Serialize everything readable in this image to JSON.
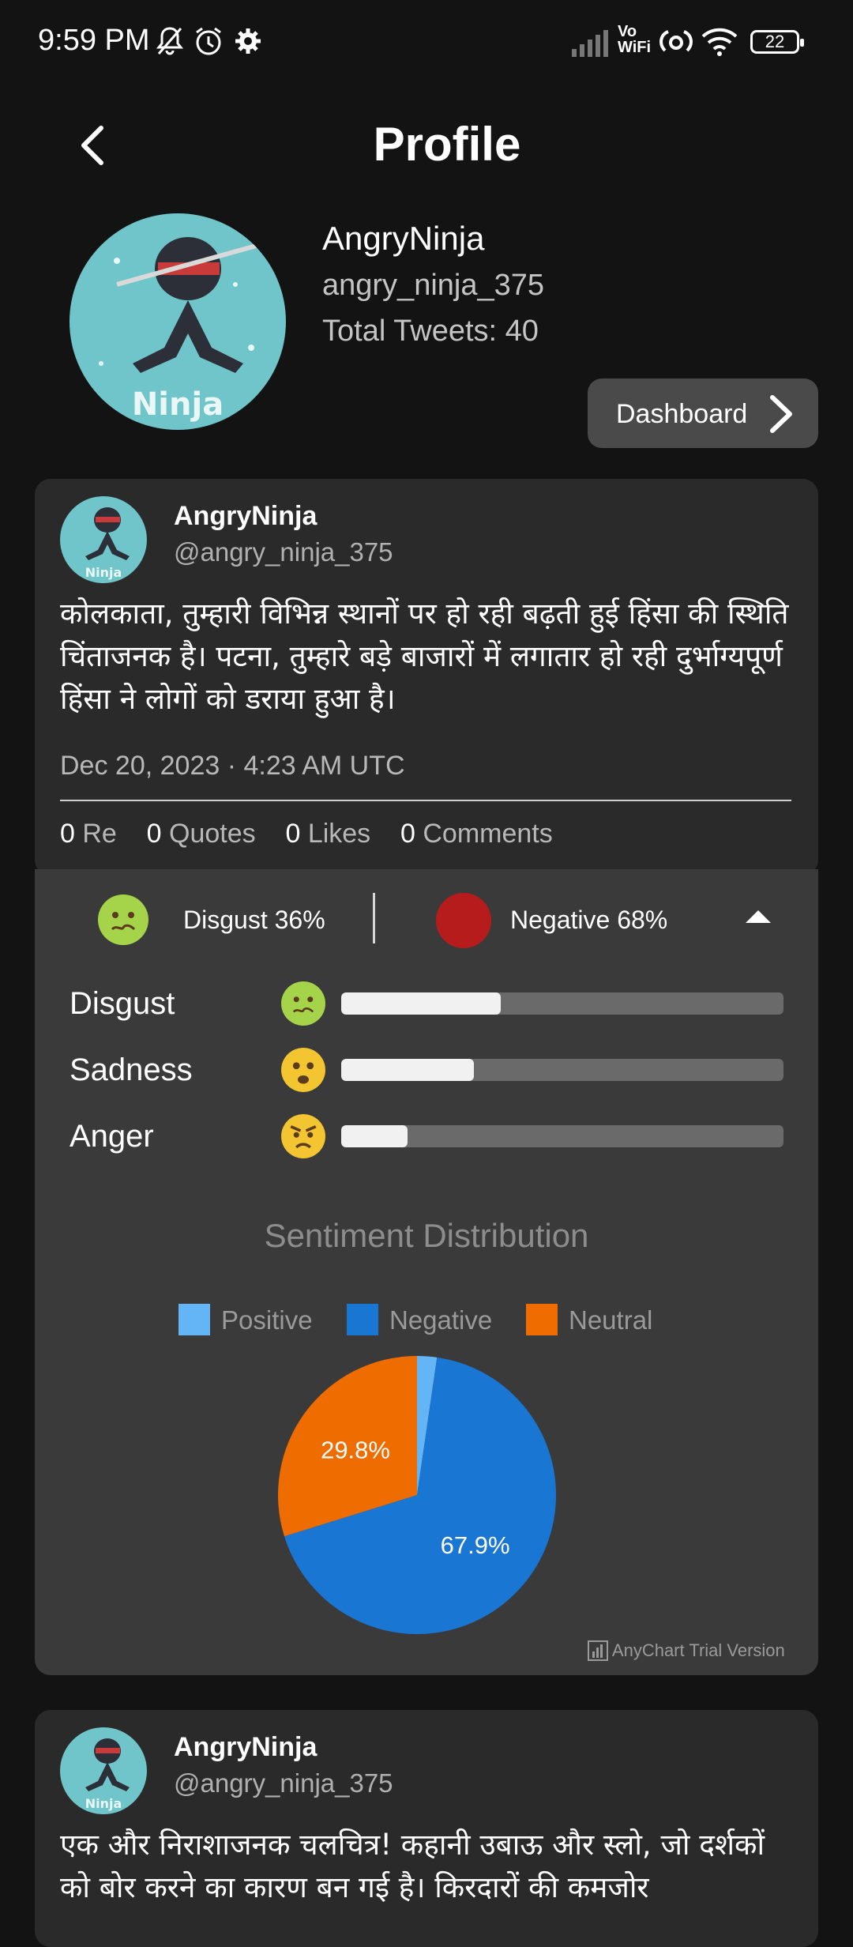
{
  "status_bar": {
    "time": "9:59 PM",
    "battery": "22",
    "vowifi_top": "Vo",
    "vowifi_bottom": "WiFi"
  },
  "header": {
    "title": "Profile"
  },
  "profile": {
    "name": "AngryNinja",
    "handle": "angry_ninja_375",
    "total_tweets": "Total Tweets: 40",
    "avatar_text": "Ninja",
    "dashboard_label": "Dashboard"
  },
  "tweets": [
    {
      "name": "AngryNinja",
      "handle": "@angry_ninja_375",
      "text": "कोलकाता, तुम्हारी विभिन्न स्थानों पर हो रही बढ़ती हुई हिंसा की स्थिति चिंताजनक है। पटना, तुम्हारे बड़े बाजारों में लगातार हो रही दुर्भाग्यपूर्ण हिंसा ने लोगों को डराया हुआ है।",
      "date": "Dec 20, 2023 · 4:23 AM UTC",
      "stats": {
        "re_count": "0",
        "re_label": "Re",
        "quotes_count": "0",
        "quotes_label": "Quotes",
        "likes_count": "0",
        "likes_label": "Likes",
        "comments_count": "0",
        "comments_label": "Comments"
      }
    },
    {
      "name": "AngryNinja",
      "handle": "@angry_ninja_375",
      "text": "एक और निराशाजनक चलचित्र! कहानी उबाऊ और स्लो, जो दर्शकों को बोर करने का कारण बन गई है। किरदारों की कमजोर"
    }
  ],
  "analysis": {
    "emotion_summary": "Disgust 36%",
    "sentiment_summary": "Negative 68%",
    "emotions": [
      {
        "label": "Disgust",
        "level": 0.36,
        "icon": "disgust-emoji-icon"
      },
      {
        "label": "Sadness",
        "level": 0.3,
        "icon": "sad-emoji-icon"
      },
      {
        "label": "Anger",
        "level": 0.15,
        "icon": "angry-emoji-icon"
      }
    ],
    "watermark": "AnyChart Trial Version"
  },
  "chart_data": {
    "type": "pie",
    "title": "Sentiment Distribution",
    "categories": [
      "Positive",
      "Negative",
      "Neutral"
    ],
    "values": [
      2.3,
      67.9,
      29.8
    ],
    "data_labels": [
      "",
      "67.9%",
      "29.8%"
    ],
    "colors": [
      "#64b5f6",
      "#1976d2",
      "#ef6c00"
    ],
    "legend": "top"
  }
}
